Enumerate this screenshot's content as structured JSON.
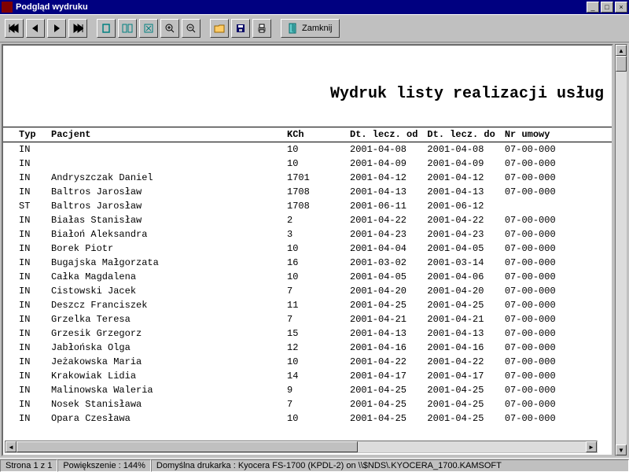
{
  "window": {
    "title": "Podgląd wydruku",
    "min": "_",
    "max": "□",
    "close": "×"
  },
  "toolbar": {
    "close_label": "Zamknij"
  },
  "document": {
    "title": "Wydruk listy realizacji usług"
  },
  "columns": {
    "typ": "Typ",
    "pacjent": "Pacjent",
    "kch": "KCh",
    "dt_od": "Dt. lecz. od",
    "dt_do": "Dt. lecz. do",
    "nr_umowy": "Nr umowy"
  },
  "rows": [
    {
      "typ": "IN",
      "pacjent": "",
      "kch": "10",
      "od": "2001-04-08",
      "do": "2001-04-08",
      "nr": "07-00-000"
    },
    {
      "typ": "IN",
      "pacjent": "",
      "kch": "10",
      "od": "2001-04-09",
      "do": "2001-04-09",
      "nr": "07-00-000"
    },
    {
      "typ": "IN",
      "pacjent": "Andryszczak Daniel",
      "kch": "1701",
      "od": "2001-04-12",
      "do": "2001-04-12",
      "nr": "07-00-000"
    },
    {
      "typ": "IN",
      "pacjent": "Baltros Jarosław",
      "kch": "1708",
      "od": "2001-04-13",
      "do": "2001-04-13",
      "nr": "07-00-000"
    },
    {
      "typ": "ST",
      "pacjent": "Baltros Jarosław",
      "kch": "1708",
      "od": "2001-06-11",
      "do": "2001-06-12",
      "nr": ""
    },
    {
      "typ": "IN",
      "pacjent": "Białas Stanisław",
      "kch": "2",
      "od": "2001-04-22",
      "do": "2001-04-22",
      "nr": "07-00-000"
    },
    {
      "typ": "IN",
      "pacjent": "Białoń Aleksandra",
      "kch": "3",
      "od": "2001-04-23",
      "do": "2001-04-23",
      "nr": "07-00-000"
    },
    {
      "typ": "IN",
      "pacjent": "Borek Piotr",
      "kch": "10",
      "od": "2001-04-04",
      "do": "2001-04-05",
      "nr": "07-00-000"
    },
    {
      "typ": "IN",
      "pacjent": "Bugajska Małgorzata",
      "kch": "16",
      "od": "2001-03-02",
      "do": "2001-03-14",
      "nr": "07-00-000"
    },
    {
      "typ": "IN",
      "pacjent": "Całka Magdalena",
      "kch": "10",
      "od": "2001-04-05",
      "do": "2001-04-06",
      "nr": "07-00-000"
    },
    {
      "typ": "IN",
      "pacjent": "Cistowski Jacek",
      "kch": "7",
      "od": "2001-04-20",
      "do": "2001-04-20",
      "nr": "07-00-000"
    },
    {
      "typ": "IN",
      "pacjent": "Deszcz Franciszek",
      "kch": "11",
      "od": "2001-04-25",
      "do": "2001-04-25",
      "nr": "07-00-000"
    },
    {
      "typ": "IN",
      "pacjent": "Grzelka Teresa",
      "kch": "7",
      "od": "2001-04-21",
      "do": "2001-04-21",
      "nr": "07-00-000"
    },
    {
      "typ": "IN",
      "pacjent": "Grzesik Grzegorz",
      "kch": "15",
      "od": "2001-04-13",
      "do": "2001-04-13",
      "nr": "07-00-000"
    },
    {
      "typ": "IN",
      "pacjent": "Jabłońska Olga",
      "kch": "12",
      "od": "2001-04-16",
      "do": "2001-04-16",
      "nr": "07-00-000"
    },
    {
      "typ": "IN",
      "pacjent": "Jeżakowska Maria",
      "kch": "10",
      "od": "2001-04-22",
      "do": "2001-04-22",
      "nr": "07-00-000"
    },
    {
      "typ": "IN",
      "pacjent": "Krakowiak Lidia",
      "kch": "14",
      "od": "2001-04-17",
      "do": "2001-04-17",
      "nr": "07-00-000"
    },
    {
      "typ": "IN",
      "pacjent": "Malinowska Waleria",
      "kch": "9",
      "od": "2001-04-25",
      "do": "2001-04-25",
      "nr": "07-00-000"
    },
    {
      "typ": "IN",
      "pacjent": "Nosek Stanisława",
      "kch": "7",
      "od": "2001-04-25",
      "do": "2001-04-25",
      "nr": "07-00-000"
    },
    {
      "typ": "IN",
      "pacjent": "Opara Czesława",
      "kch": "10",
      "od": "2001-04-25",
      "do": "2001-04-25",
      "nr": "07-00-000"
    }
  ],
  "status": {
    "page": "Strona 1 z 1",
    "zoom": "Powiększenie : 144%",
    "printer": "Domyślna drukarka : Kyocera FS-1700 (KPDL-2) on \\\\$NDS\\.KYOCERA_1700.KAMSOFT"
  }
}
